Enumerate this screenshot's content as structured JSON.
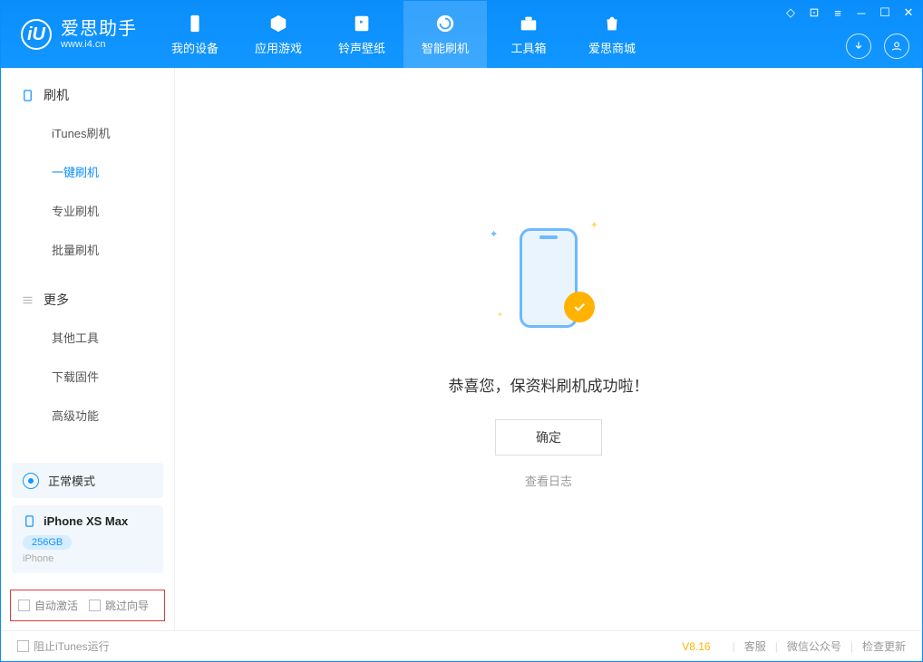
{
  "app": {
    "title": "爱思助手",
    "subtitle": "www.i4.cn"
  },
  "tabs": [
    {
      "label": "我的设备",
      "icon": "device"
    },
    {
      "label": "应用游戏",
      "icon": "cube"
    },
    {
      "label": "铃声壁纸",
      "icon": "music"
    },
    {
      "label": "智能刷机",
      "icon": "refresh",
      "active": true
    },
    {
      "label": "工具箱",
      "icon": "toolbox"
    },
    {
      "label": "爱思商城",
      "icon": "bag"
    }
  ],
  "sidebar": {
    "section1": {
      "title": "刷机",
      "items": [
        "iTunes刷机",
        "一键刷机",
        "专业刷机",
        "批量刷机"
      ],
      "activeIndex": 1
    },
    "section2": {
      "title": "更多",
      "items": [
        "其他工具",
        "下载固件",
        "高级功能"
      ]
    }
  },
  "mode": {
    "label": "正常模式"
  },
  "device": {
    "name": "iPhone XS Max",
    "storage": "256GB",
    "type": "iPhone"
  },
  "checks": {
    "autoActivate": "自动激活",
    "skipGuide": "跳过向导"
  },
  "main": {
    "message": "恭喜您，保资料刷机成功啦！",
    "okButton": "确定",
    "logLink": "查看日志"
  },
  "footer": {
    "blockItunes": "阻止iTunes运行",
    "version": "V8.16",
    "links": [
      "客服",
      "微信公众号",
      "检查更新"
    ]
  }
}
